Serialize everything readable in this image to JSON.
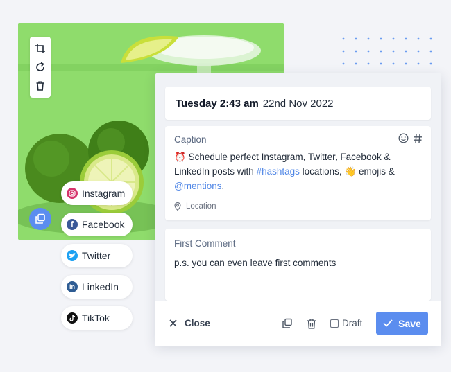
{
  "colors": {
    "accent": "#5b8def",
    "photo_background": "#8fdc6c",
    "hashtag": "#4f86e6"
  },
  "photo_tools": {
    "icons": [
      "crop-icon",
      "rotate-icon",
      "trash-icon"
    ]
  },
  "social_networks": [
    {
      "label": "Instagram",
      "icon": "instagram-icon",
      "color": "#d6336c"
    },
    {
      "label": "Facebook",
      "icon": "facebook-icon",
      "color": "#3b5998"
    },
    {
      "label": "Twitter",
      "icon": "twitter-icon",
      "color": "#1da1f2"
    },
    {
      "label": "LinkedIn",
      "icon": "linkedin-icon",
      "color": "#2e5c93"
    },
    {
      "label": "TikTok",
      "icon": "tiktok-icon",
      "color": "#111111"
    }
  ],
  "schedule": {
    "time": "Tuesday 2:43 am",
    "date": "22nd Nov 2022"
  },
  "caption": {
    "label": "Caption",
    "alarm_emoji": "⏰",
    "text_part1": " Schedule perfect Instagram, Twitter, Facebook & LinkedIn posts with ",
    "hashtags_link": "#hashtags",
    "text_part2": " locations, ",
    "wave_emoji": "👋",
    "text_part3": " emojis & ",
    "mentions_link": "@mentions",
    "text_part4": ".",
    "location_label": "Location"
  },
  "first_comment": {
    "label": "First Comment",
    "text": "p.s. you can even leave first comments"
  },
  "footer": {
    "close_label": "Close",
    "draft_label": "Draft",
    "save_label": "Save"
  }
}
